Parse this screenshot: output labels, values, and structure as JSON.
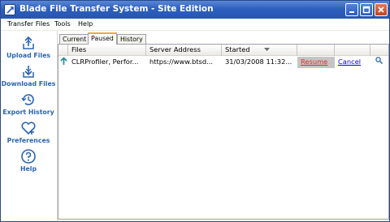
{
  "window": {
    "title": "Blade File Transfer System - Site Edition"
  },
  "menu": [
    "Transfer Files",
    "Tools",
    "Help"
  ],
  "sidebar": {
    "items": [
      {
        "label": "Upload Files",
        "icon": "upload-icon"
      },
      {
        "label": "Download Files",
        "icon": "download-icon"
      },
      {
        "label": "Export History",
        "icon": "history-icon"
      },
      {
        "label": "Preferences",
        "icon": "heart-plus-icon"
      },
      {
        "label": "Help",
        "icon": "help-icon"
      }
    ]
  },
  "tabs": [
    {
      "label": "Current",
      "active": false
    },
    {
      "label": "Paused",
      "active": true
    },
    {
      "label": "History",
      "active": false
    }
  ],
  "table": {
    "columns": [
      "Files",
      "Server Address",
      "Started"
    ],
    "rows": [
      {
        "file": "CLRProfiler, Perfor...",
        "server": "https://www.btsd...",
        "started": "31/03/2008 11:32...",
        "resume": "Resume",
        "cancel": "Cancel"
      }
    ]
  },
  "colors": {
    "titlebar": "#2d5fbe",
    "sidebar_label": "#2a65b0",
    "link": "#0000d8",
    "resume_text": "#e02b2b",
    "active_tab_accent": "#f0a93a"
  }
}
